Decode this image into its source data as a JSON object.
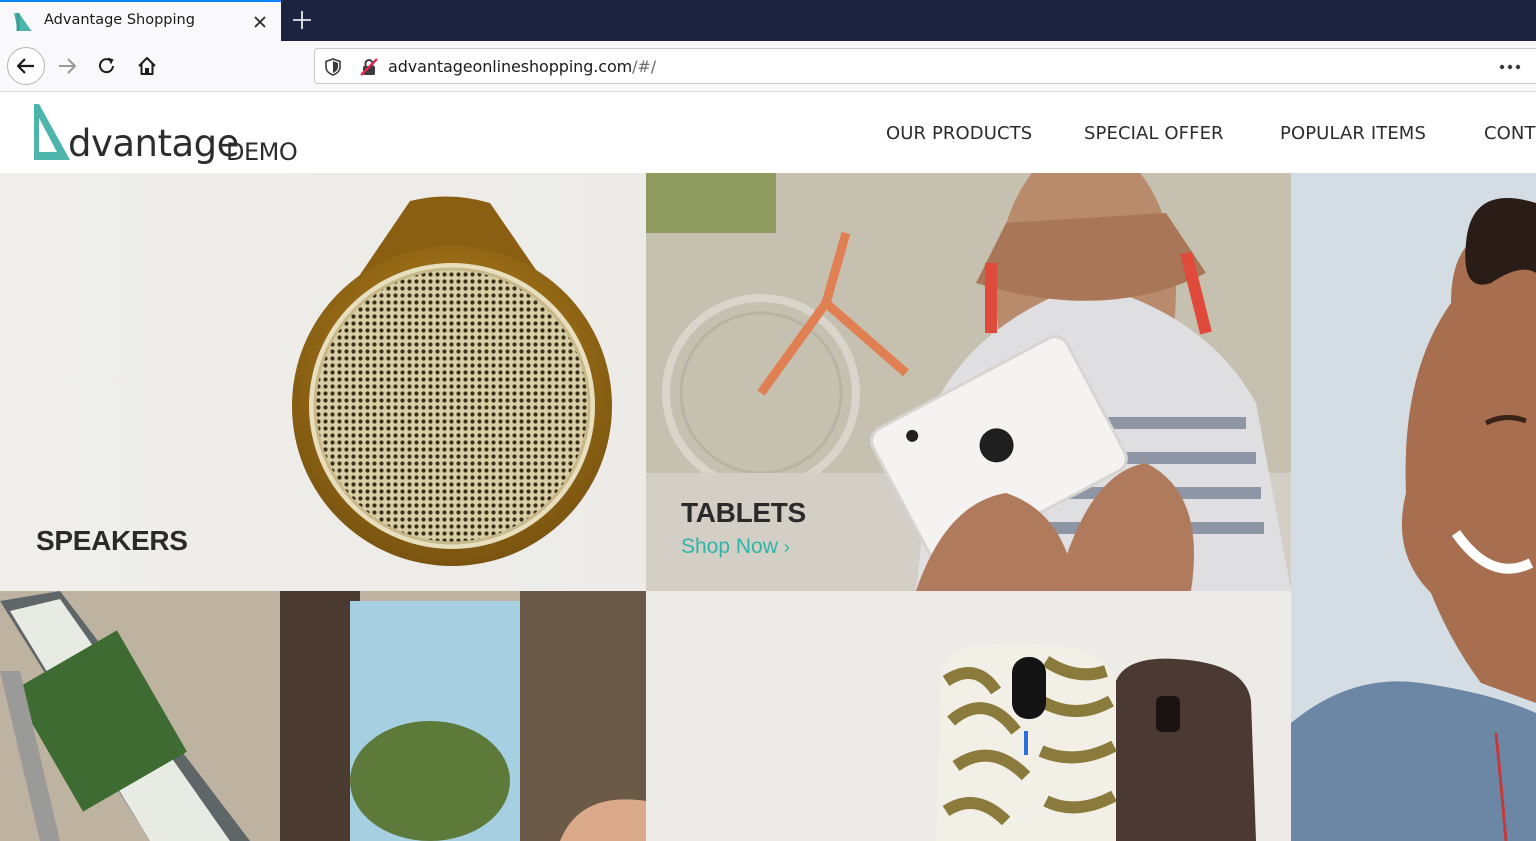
{
  "browser": {
    "tab_title": "Advantage Shopping",
    "url_host": "advantageonlineshopping.com",
    "url_path": "/#/",
    "accent_color": "#0a84ff",
    "icons": {
      "back": "back-arrow-icon",
      "forward": "forward-arrow-icon",
      "reload": "reload-icon",
      "home": "home-icon",
      "tracking": "shield-icon",
      "insecure": "insecure-lock-icon",
      "more": "more-dots-icon",
      "close_tab": "close-icon",
      "new_tab": "plus-icon"
    }
  },
  "site": {
    "logo_word": "dvantage",
    "logo_demo": "DEMO",
    "brand_color": "#4db5ab",
    "menu": [
      {
        "label": "OUR PRODUCTS"
      },
      {
        "label": "SPECIAL OFFER"
      },
      {
        "label": "POPULAR ITEMS"
      },
      {
        "label": "CONT"
      }
    ]
  },
  "tiles": {
    "speakers": {
      "title": "SPEAKERS"
    },
    "tablets": {
      "title": "TABLETS",
      "link": "Shop Now",
      "link_color": "#2fb5a6"
    }
  }
}
